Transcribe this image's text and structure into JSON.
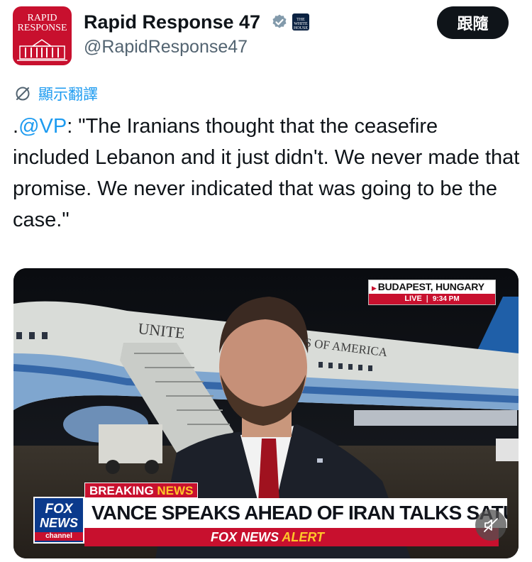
{
  "account": {
    "avatar_line1": "RAPID",
    "avatar_line2": "RESPONSE",
    "name": "Rapid Response 47",
    "handle": "@RapidResponse47",
    "badge_text_1": "THE",
    "badge_text_2": "WHITE",
    "badge_text_3": "HOUSE"
  },
  "follow_label": "跟隨",
  "translate_label": "顯示翻譯",
  "tweet": {
    "prefix": ".",
    "mention": "@VP",
    "body": ": \"The Iranians thought that the ceasefire included Lebanon and it just didn't. We never made that promise. We never indicated that was going to be the case.\""
  },
  "video": {
    "location": "BUDAPEST, HUNGARY",
    "live": "LIVE",
    "time": "9:34 PM",
    "breaking_1": "BREAKING ",
    "breaking_2": "NEWS",
    "headline": "VANCE SPEAKS AHEAD OF IRAN TALKS SATURDAY",
    "alert_1": "FOX NEWS ",
    "alert_2": "ALERT",
    "logo_1": "FOX",
    "logo_2": "NEWS",
    "logo_3": "channel",
    "plane_text_1": "UNITE",
    "plane_text_2": "S OF AMERICA"
  },
  "colors": {
    "accent": "#1d9bf0",
    "fox_red": "#c8102e",
    "fox_blue": "#0b3a8c",
    "fox_yellow": "#ffc629"
  },
  "icons": [
    "verified-icon",
    "white-house-badge-icon",
    "translate-icon",
    "mute-icon"
  ]
}
